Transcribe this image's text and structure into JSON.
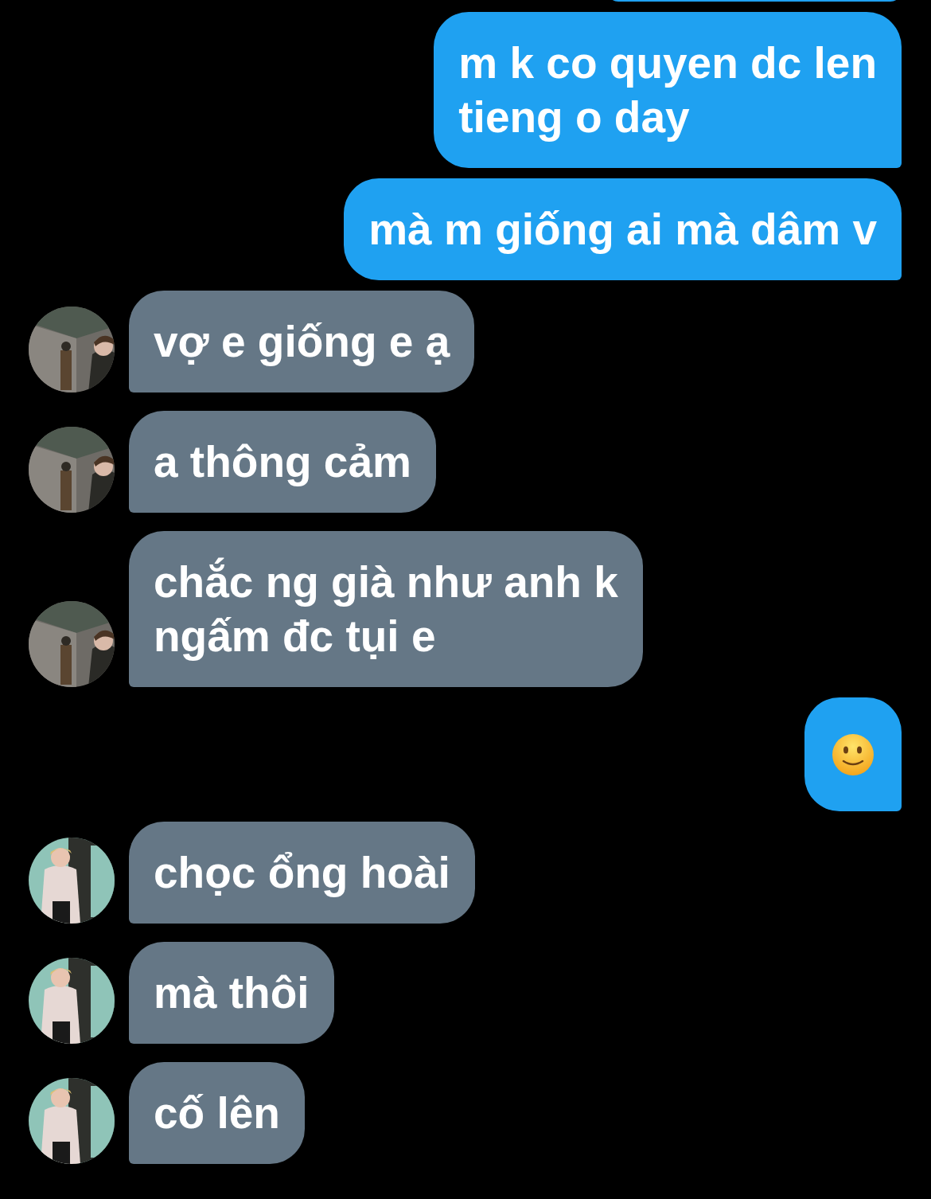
{
  "messages": [
    {
      "kind": "partial",
      "outgoing": true
    },
    {
      "kind": "text",
      "outgoing": true,
      "text": "m k co quyen dc len\ntieng o day"
    },
    {
      "kind": "text",
      "outgoing": true,
      "text": "mà m giống ai mà dâm v"
    },
    {
      "kind": "text",
      "outgoing": false,
      "text": "vợ e giống e ạ"
    },
    {
      "kind": "text",
      "outgoing": false,
      "text": "a thông cảm"
    },
    {
      "kind": "text",
      "outgoing": false,
      "text": "chắc ng già như anh k\nngấm đc tụi e"
    },
    {
      "kind": "emoji",
      "outgoing": true
    },
    {
      "kind": "text",
      "outgoing": false,
      "text": "chọc ổng hoài"
    },
    {
      "kind": "text",
      "outgoing": false,
      "text": "mà thôi"
    },
    {
      "kind": "text",
      "outgoing": false,
      "text": "cố lên"
    }
  ]
}
